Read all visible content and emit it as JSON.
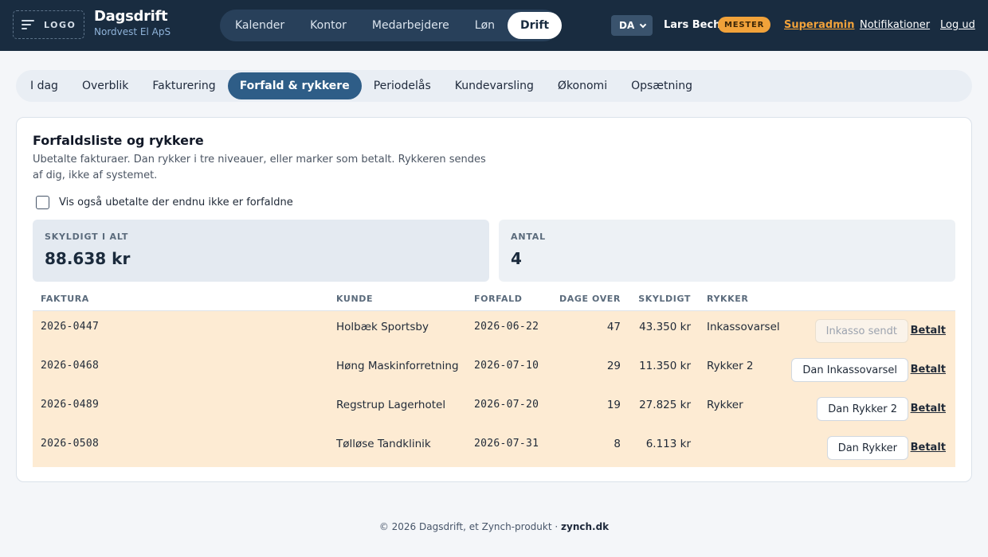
{
  "header": {
    "logo_text": "LOGO",
    "brand_title": "Dagsdrift",
    "brand_subtitle": "Nordvest El ApS",
    "nav": [
      {
        "label": "Kalender"
      },
      {
        "label": "Kontor"
      },
      {
        "label": "Medarbejdere"
      },
      {
        "label": "Løn"
      },
      {
        "label": "Drift",
        "active": true
      }
    ],
    "language": "DA",
    "user_name": "Lars Bech",
    "role_badge": "MESTER",
    "links": {
      "superadmin": "Superadmin",
      "notifications": "Notifikationer",
      "logout": "Log ud"
    },
    "colors": {
      "bar": "#192c40",
      "accent": "#f1a23a"
    }
  },
  "subnav": [
    {
      "label": "I dag"
    },
    {
      "label": "Overblik"
    },
    {
      "label": "Fakturering"
    },
    {
      "label": "Forfald & rykkere",
      "active": true
    },
    {
      "label": "Periodelås"
    },
    {
      "label": "Kundevarsling"
    },
    {
      "label": "Økonomi"
    },
    {
      "label": "Opsætning"
    }
  ],
  "card": {
    "title": "Forfaldsliste og rykkere",
    "description": "Ubetalte fakturaer. Dan rykker i tre niveauer, eller marker som betalt. Rykkeren sendes af dig, ikke af systemet.",
    "checkbox_label": "Vis også ubetalte der endnu ikke er forfaldne",
    "checkbox_checked": false,
    "stats": {
      "total_label": "SKYLDIGT I ALT",
      "total_value": "88.638 kr",
      "count_label": "ANTAL",
      "count_value": "4"
    },
    "table": {
      "columns": {
        "faktura": "FAKTURA",
        "kunde": "KUNDE",
        "forfald": "FORFALD",
        "dage": "DAGE OVER",
        "skyldigt": "SKYLDIGT",
        "rykker": "RYKKER"
      },
      "paid_label": "Betalt",
      "rows": [
        {
          "faktura": "2026-0447",
          "kunde": "Holbæk Sportsby",
          "forfald": "2026-06-22",
          "dage": "47",
          "skyldigt": "43.350 kr",
          "rykker": "Inkassovarsel",
          "action": "Inkasso sendt",
          "action_disabled": true
        },
        {
          "faktura": "2026-0468",
          "kunde": "Høng Maskinforretning",
          "forfald": "2026-07-10",
          "dage": "29",
          "skyldigt": "11.350 kr",
          "rykker": "Rykker 2",
          "action": "Dan Inkassovarsel",
          "action_disabled": false
        },
        {
          "faktura": "2026-0489",
          "kunde": "Regstrup Lagerhotel",
          "forfald": "2026-07-20",
          "dage": "19",
          "skyldigt": "27.825 kr",
          "rykker": "Rykker",
          "action": "Dan Rykker 2",
          "action_disabled": false
        },
        {
          "faktura": "2026-0508",
          "kunde": "Tølløse Tandklinik",
          "forfald": "2026-07-31",
          "dage": "8",
          "skyldigt": "6.113 kr",
          "rykker": "",
          "action": "Dan Rykker",
          "action_disabled": false
        }
      ]
    }
  },
  "footer": {
    "text": "© 2026 Dagsdrift, et Zynch-produkt · ",
    "link": "zynch.dk"
  }
}
